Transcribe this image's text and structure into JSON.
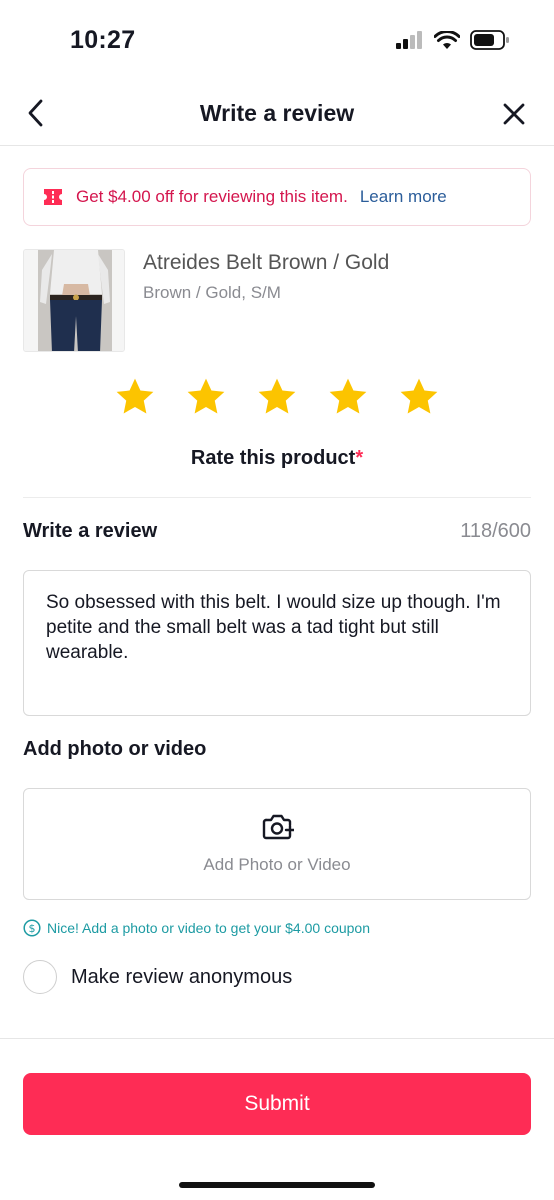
{
  "status_bar": {
    "time": "10:27",
    "icons": [
      "cellular-signal-icon",
      "wifi-icon",
      "battery-icon"
    ]
  },
  "nav": {
    "title": "Write a review",
    "back_icon": "chevron-left-icon",
    "close_icon": "close-icon"
  },
  "promo": {
    "icon": "coupon-ticket-icon",
    "text": "Get $4.00 off for reviewing this item.",
    "link": "Learn more"
  },
  "product": {
    "name": "Atreides Belt Brown / Gold",
    "variant": "Brown / Gold, S/M"
  },
  "rating": {
    "stars_selected": 5,
    "stars_total": 5,
    "label": "Rate this product",
    "required_mark": "*"
  },
  "review": {
    "heading": "Write a review",
    "count": "118/600",
    "text": "So obsessed with this belt. I would size up though. I'm petite and the small belt was a tad tight but still wearable."
  },
  "media": {
    "heading": "Add photo or video",
    "button_label": "Add Photo or Video",
    "icon": "camera-plus-icon",
    "tip": "Nice! Add a photo or video to get your $4.00 coupon"
  },
  "anonymous": {
    "label": "Make review anonymous",
    "checked": false
  },
  "submit": {
    "label": "Submit"
  },
  "colors": {
    "accent": "#fe2c55",
    "promo_text": "#d4164e",
    "link": "#2b5d9a",
    "star": "#fcc400",
    "tip": "#1d9ba3"
  }
}
